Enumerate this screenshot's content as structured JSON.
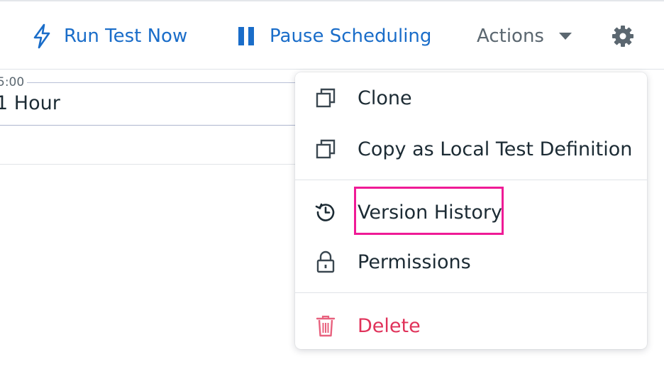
{
  "toolbar": {
    "run_test_label": "Run Test Now",
    "pause_label": "Pause Scheduling",
    "actions_label": "Actions"
  },
  "background": {
    "time_label": "5:00",
    "hour_text": "1 Hour"
  },
  "menu": {
    "items": [
      {
        "label": "Clone",
        "icon": "clone-icon"
      },
      {
        "label": "Copy as Local Test Definition",
        "icon": "copy-icon"
      },
      {
        "label": "Version History",
        "icon": "history-icon"
      },
      {
        "label": "Permissions",
        "icon": "lock-icon"
      },
      {
        "label": "Delete",
        "icon": "trash-icon"
      }
    ]
  },
  "colors": {
    "accent": "#1a6dc9",
    "danger": "#e0325a",
    "highlight": "#ef1b96"
  }
}
